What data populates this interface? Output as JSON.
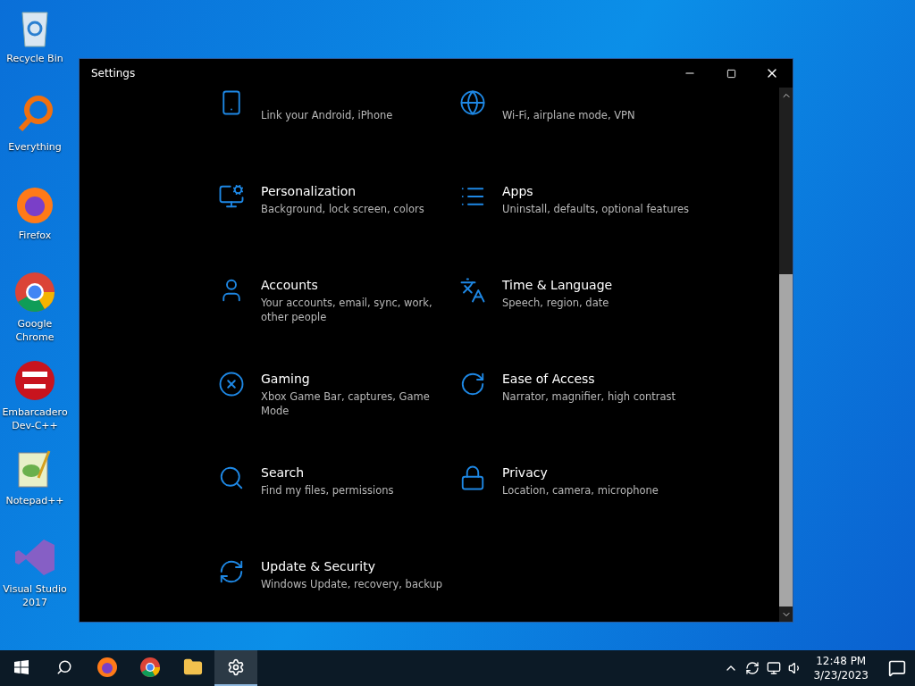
{
  "desktop_icons": [
    {
      "label": "Recycle Bin"
    },
    {
      "label": "Everything"
    },
    {
      "label": "Firefox"
    },
    {
      "label": "Google Chrome"
    },
    {
      "label": "Embarcadero Dev-C++"
    },
    {
      "label": "Notepad++"
    },
    {
      "label": "Visual Studio 2017"
    }
  ],
  "window": {
    "title": "Settings"
  },
  "categories": [
    {
      "description": "Link your Android, iPhone"
    },
    {
      "description": "Wi-Fi, airplane mode, VPN"
    },
    {
      "title": "Personalization",
      "description": "Background, lock screen, colors"
    },
    {
      "title": "Apps",
      "description": "Uninstall, defaults, optional features"
    },
    {
      "title": "Accounts",
      "description": "Your accounts, email, sync, work, other people"
    },
    {
      "title": "Time & Language",
      "description": "Speech, region, date"
    },
    {
      "title": "Gaming",
      "description": "Xbox Game Bar, captures, Game Mode"
    },
    {
      "title": "Ease of Access",
      "description": "Narrator, magnifier, high contrast"
    },
    {
      "title": "Search",
      "description": "Find my files, permissions"
    },
    {
      "title": "Privacy",
      "description": "Location, camera, microphone"
    },
    {
      "title": "Update & Security",
      "description": "Windows Update, recovery, backup"
    }
  ],
  "taskbar": {
    "items": [
      {
        "selected": false
      },
      {
        "selected": false
      },
      {
        "selected": false
      },
      {
        "selected": false
      },
      {
        "selected": false
      },
      {
        "selected": true
      }
    ],
    "time": "12:48 PM",
    "date": "3/23/2023"
  }
}
